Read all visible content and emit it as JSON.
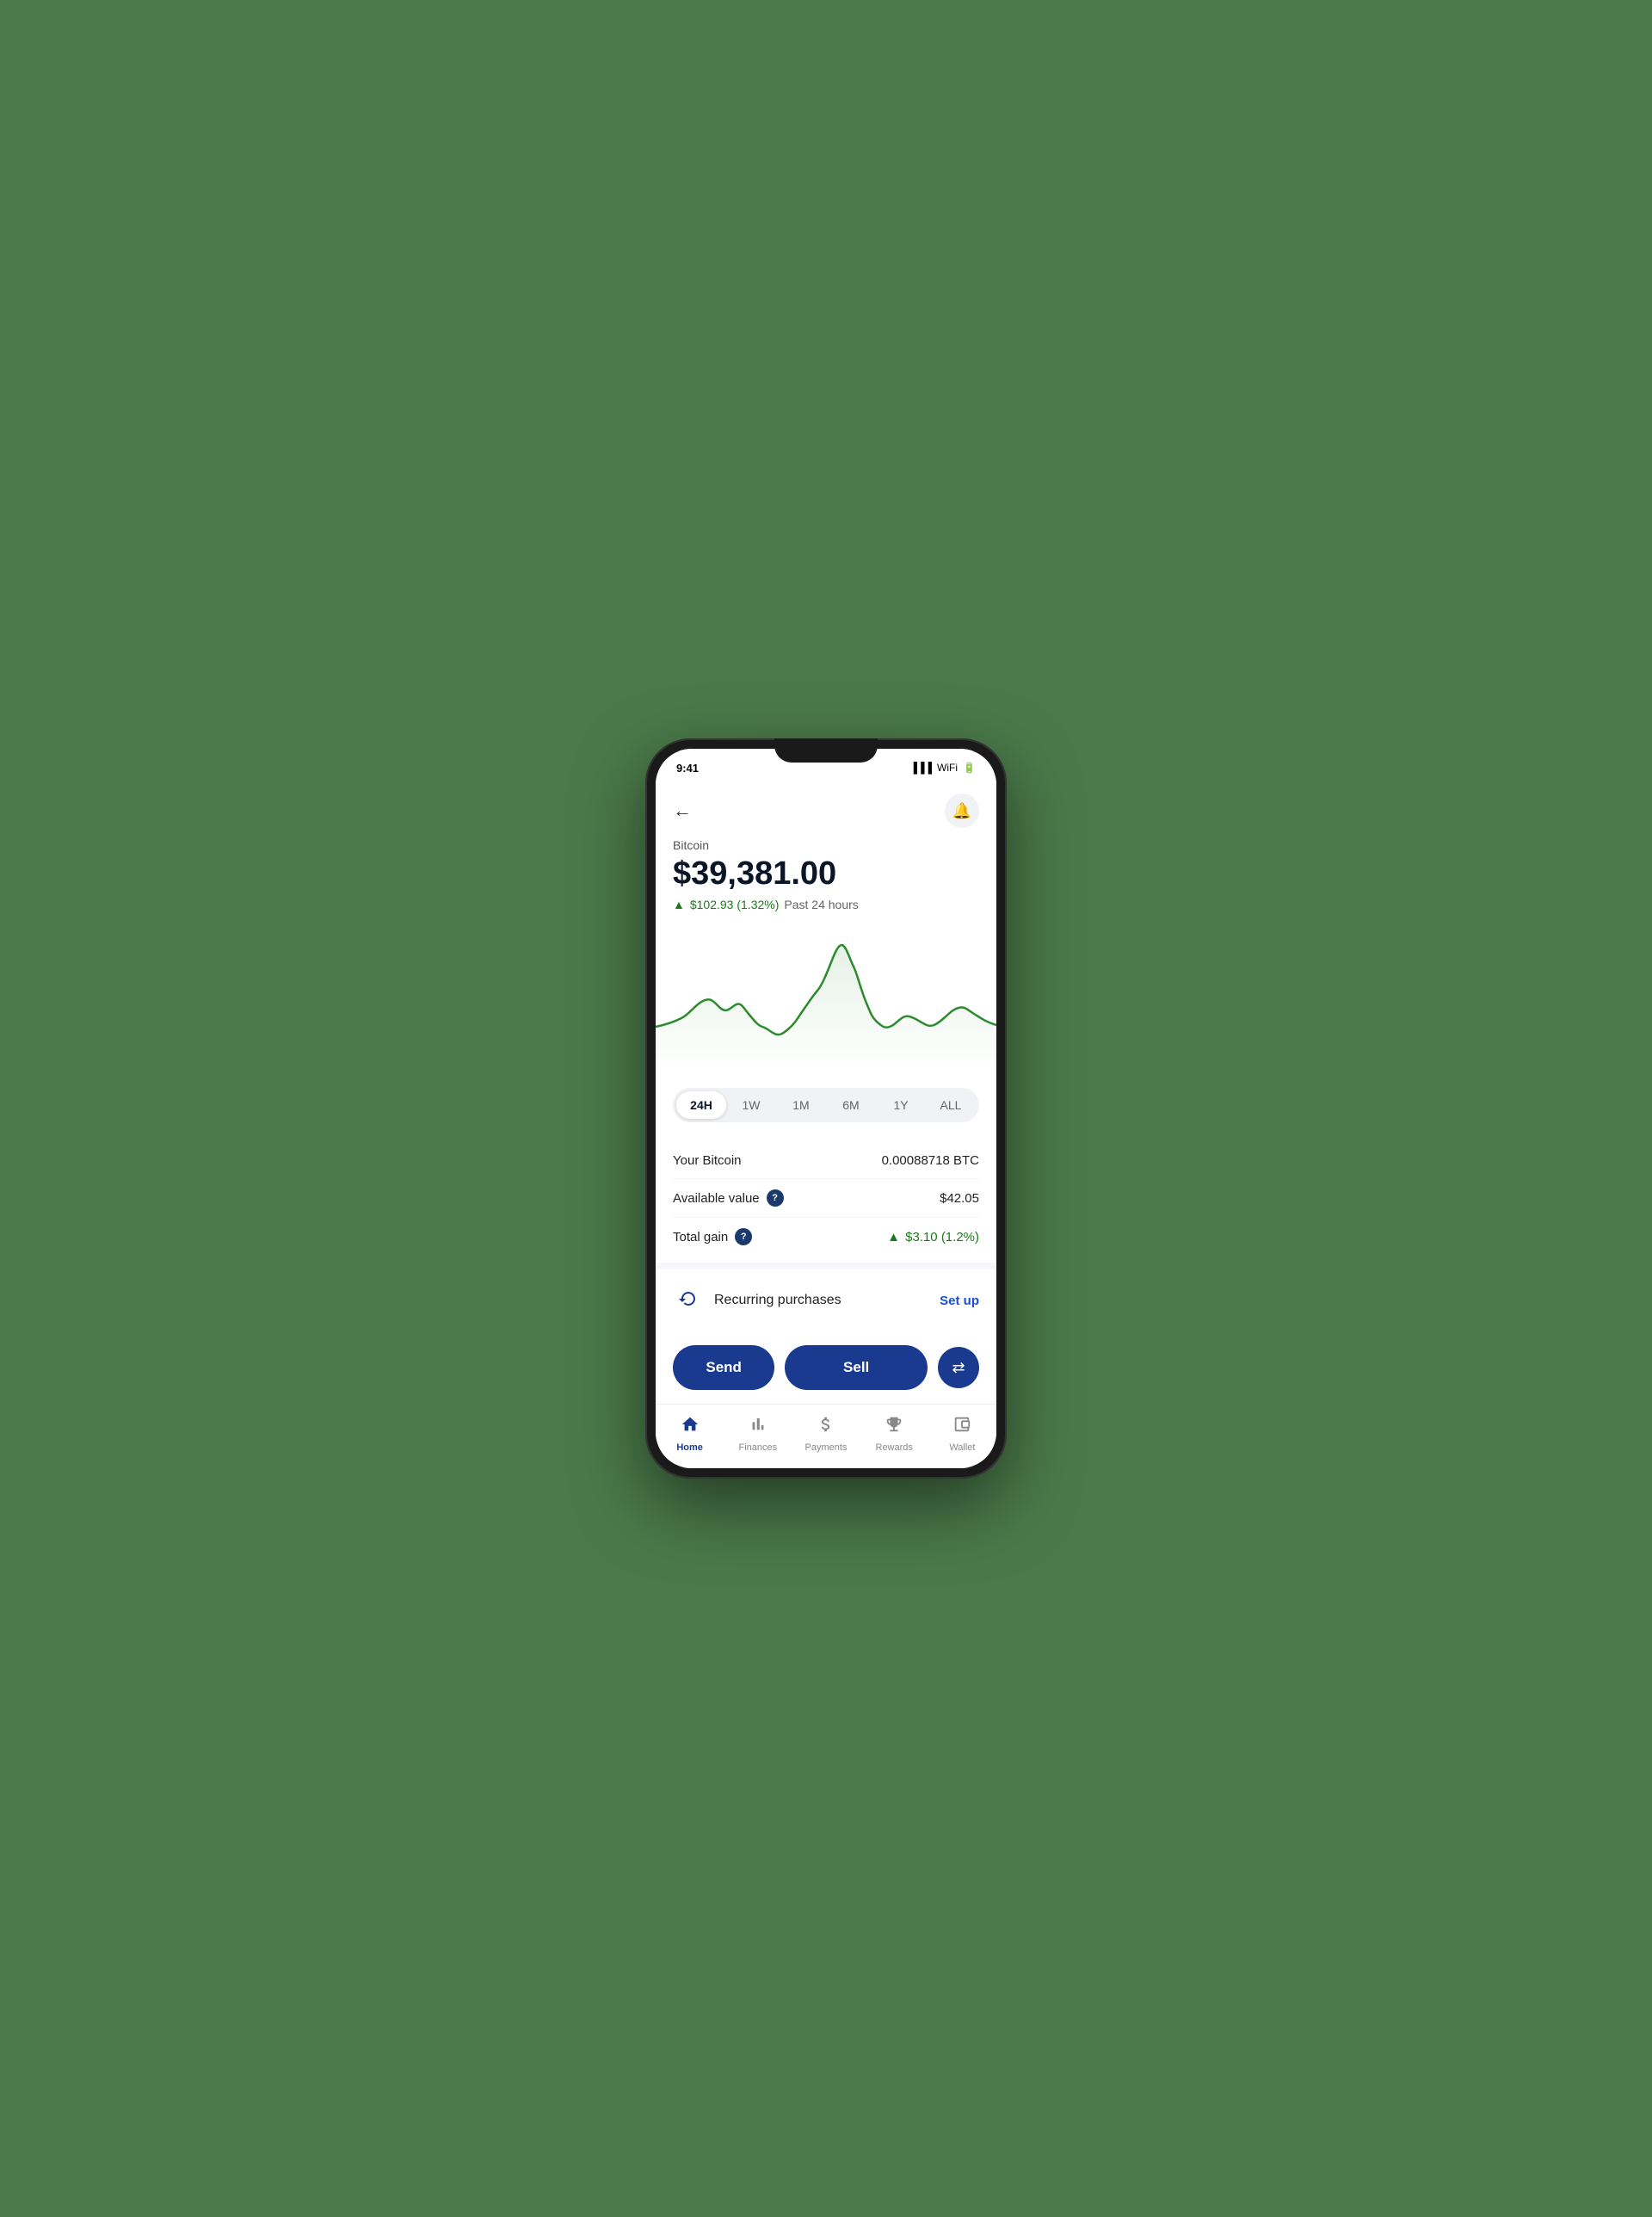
{
  "phone": {
    "status_time": "9:41"
  },
  "header": {
    "back_label": "←",
    "bell_icon": "🔔"
  },
  "price_section": {
    "coin_name": "Bitcoin",
    "price": "$39,381.00",
    "change_amount": "$102.93 (1.32%)",
    "change_arrow": "↑",
    "period_label": "Past 24 hours"
  },
  "time_selector": {
    "options": [
      "24H",
      "1W",
      "1M",
      "6M",
      "1Y",
      "ALL"
    ],
    "active_index": 0
  },
  "stats": {
    "your_bitcoin_label": "Your Bitcoin",
    "your_bitcoin_value": "0.00088718 BTC",
    "available_value_label": "Available value",
    "available_value_value": "$42.05",
    "total_gain_label": "Total gain",
    "total_gain_value": "↑ $3.10 (1.2%)"
  },
  "recurring": {
    "icon": "↺",
    "label": "Recurring purchases",
    "setup_label": "Set up"
  },
  "actions": {
    "send_label": "Send",
    "sell_label": "Sell",
    "swap_icon": "⇄"
  },
  "bottom_nav": [
    {
      "id": "home",
      "icon": "🏠",
      "label": "Home",
      "active": true
    },
    {
      "id": "finances",
      "icon": "📊",
      "label": "Finances",
      "active": false
    },
    {
      "id": "payments",
      "icon": "💲",
      "label": "Payments",
      "active": false
    },
    {
      "id": "rewards",
      "icon": "🏆",
      "label": "Rewards",
      "active": false
    },
    {
      "id": "wallet",
      "icon": "▤",
      "label": "Wallet",
      "active": false
    }
  ]
}
